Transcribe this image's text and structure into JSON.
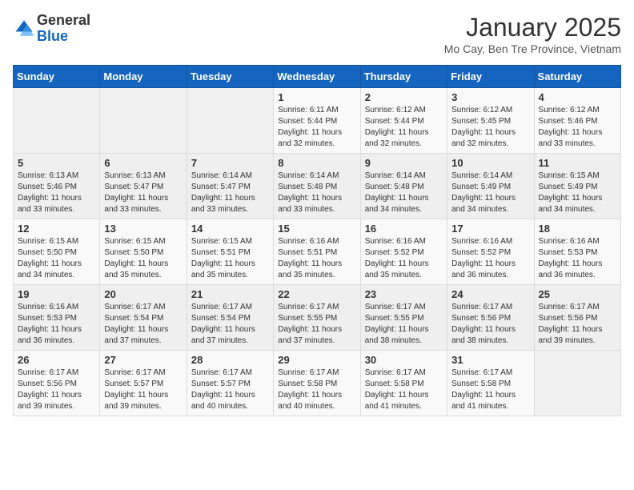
{
  "header": {
    "logo_general": "General",
    "logo_blue": "Blue",
    "month_title": "January 2025",
    "location": "Mo Cay, Ben Tre Province, Vietnam"
  },
  "days_of_week": [
    "Sunday",
    "Monday",
    "Tuesday",
    "Wednesday",
    "Thursday",
    "Friday",
    "Saturday"
  ],
  "weeks": [
    [
      {
        "day": "",
        "info": ""
      },
      {
        "day": "",
        "info": ""
      },
      {
        "day": "",
        "info": ""
      },
      {
        "day": "1",
        "info": "Sunrise: 6:11 AM\nSunset: 5:44 PM\nDaylight: 11 hours and 32 minutes."
      },
      {
        "day": "2",
        "info": "Sunrise: 6:12 AM\nSunset: 5:44 PM\nDaylight: 11 hours and 32 minutes."
      },
      {
        "day": "3",
        "info": "Sunrise: 6:12 AM\nSunset: 5:45 PM\nDaylight: 11 hours and 32 minutes."
      },
      {
        "day": "4",
        "info": "Sunrise: 6:12 AM\nSunset: 5:46 PM\nDaylight: 11 hours and 33 minutes."
      }
    ],
    [
      {
        "day": "5",
        "info": "Sunrise: 6:13 AM\nSunset: 5:46 PM\nDaylight: 11 hours and 33 minutes."
      },
      {
        "day": "6",
        "info": "Sunrise: 6:13 AM\nSunset: 5:47 PM\nDaylight: 11 hours and 33 minutes."
      },
      {
        "day": "7",
        "info": "Sunrise: 6:14 AM\nSunset: 5:47 PM\nDaylight: 11 hours and 33 minutes."
      },
      {
        "day": "8",
        "info": "Sunrise: 6:14 AM\nSunset: 5:48 PM\nDaylight: 11 hours and 33 minutes."
      },
      {
        "day": "9",
        "info": "Sunrise: 6:14 AM\nSunset: 5:48 PM\nDaylight: 11 hours and 34 minutes."
      },
      {
        "day": "10",
        "info": "Sunrise: 6:14 AM\nSunset: 5:49 PM\nDaylight: 11 hours and 34 minutes."
      },
      {
        "day": "11",
        "info": "Sunrise: 6:15 AM\nSunset: 5:49 PM\nDaylight: 11 hours and 34 minutes."
      }
    ],
    [
      {
        "day": "12",
        "info": "Sunrise: 6:15 AM\nSunset: 5:50 PM\nDaylight: 11 hours and 34 minutes."
      },
      {
        "day": "13",
        "info": "Sunrise: 6:15 AM\nSunset: 5:50 PM\nDaylight: 11 hours and 35 minutes."
      },
      {
        "day": "14",
        "info": "Sunrise: 6:15 AM\nSunset: 5:51 PM\nDaylight: 11 hours and 35 minutes."
      },
      {
        "day": "15",
        "info": "Sunrise: 6:16 AM\nSunset: 5:51 PM\nDaylight: 11 hours and 35 minutes."
      },
      {
        "day": "16",
        "info": "Sunrise: 6:16 AM\nSunset: 5:52 PM\nDaylight: 11 hours and 35 minutes."
      },
      {
        "day": "17",
        "info": "Sunrise: 6:16 AM\nSunset: 5:52 PM\nDaylight: 11 hours and 36 minutes."
      },
      {
        "day": "18",
        "info": "Sunrise: 6:16 AM\nSunset: 5:53 PM\nDaylight: 11 hours and 36 minutes."
      }
    ],
    [
      {
        "day": "19",
        "info": "Sunrise: 6:16 AM\nSunset: 5:53 PM\nDaylight: 11 hours and 36 minutes."
      },
      {
        "day": "20",
        "info": "Sunrise: 6:17 AM\nSunset: 5:54 PM\nDaylight: 11 hours and 37 minutes."
      },
      {
        "day": "21",
        "info": "Sunrise: 6:17 AM\nSunset: 5:54 PM\nDaylight: 11 hours and 37 minutes."
      },
      {
        "day": "22",
        "info": "Sunrise: 6:17 AM\nSunset: 5:55 PM\nDaylight: 11 hours and 37 minutes."
      },
      {
        "day": "23",
        "info": "Sunrise: 6:17 AM\nSunset: 5:55 PM\nDaylight: 11 hours and 38 minutes."
      },
      {
        "day": "24",
        "info": "Sunrise: 6:17 AM\nSunset: 5:56 PM\nDaylight: 11 hours and 38 minutes."
      },
      {
        "day": "25",
        "info": "Sunrise: 6:17 AM\nSunset: 5:56 PM\nDaylight: 11 hours and 39 minutes."
      }
    ],
    [
      {
        "day": "26",
        "info": "Sunrise: 6:17 AM\nSunset: 5:56 PM\nDaylight: 11 hours and 39 minutes."
      },
      {
        "day": "27",
        "info": "Sunrise: 6:17 AM\nSunset: 5:57 PM\nDaylight: 11 hours and 39 minutes."
      },
      {
        "day": "28",
        "info": "Sunrise: 6:17 AM\nSunset: 5:57 PM\nDaylight: 11 hours and 40 minutes."
      },
      {
        "day": "29",
        "info": "Sunrise: 6:17 AM\nSunset: 5:58 PM\nDaylight: 11 hours and 40 minutes."
      },
      {
        "day": "30",
        "info": "Sunrise: 6:17 AM\nSunset: 5:58 PM\nDaylight: 11 hours and 41 minutes."
      },
      {
        "day": "31",
        "info": "Sunrise: 6:17 AM\nSunset: 5:58 PM\nDaylight: 11 hours and 41 minutes."
      },
      {
        "day": "",
        "info": ""
      }
    ]
  ]
}
